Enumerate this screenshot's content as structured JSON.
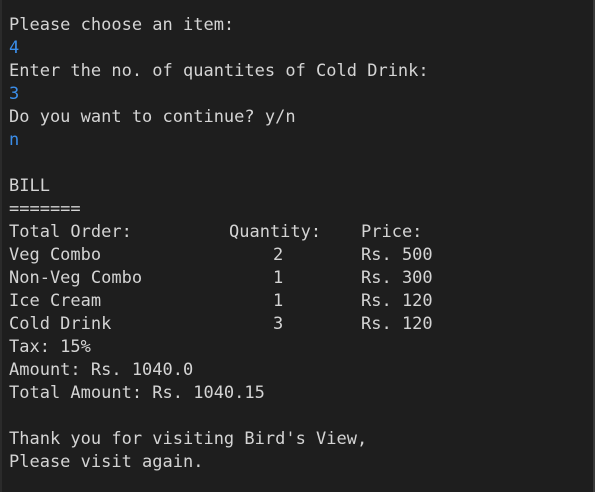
{
  "terminal": {
    "prompt_choose": "Please choose an item:",
    "input_item": "4",
    "prompt_quantity": "Enter the no. of quantites of Cold Drink:",
    "input_quantity": "3",
    "prompt_continue": "Do you want to continue? y/n",
    "input_continue": "n",
    "bill_title": "BILL",
    "bill_rule": "=======",
    "headers": {
      "item": "Total Order:",
      "quantity": "Quantity:",
      "price": "Price:"
    },
    "rows": [
      {
        "item": "Veg Combo",
        "quantity": "2",
        "price": "Rs. 500"
      },
      {
        "item": "Non-Veg Combo",
        "quantity": "1",
        "price": "Rs. 300"
      },
      {
        "item": "Ice Cream",
        "quantity": "1",
        "price": "Rs. 120"
      },
      {
        "item": "Cold Drink",
        "quantity": "3",
        "price": "Rs. 120"
      }
    ],
    "tax": "Tax: 15%",
    "amount": "Amount: Rs. 1040.0",
    "total": "Total Amount: Rs. 1040.15",
    "thanks": "Thank you for visiting Bird's View,",
    "visit_again": "Please visit again."
  },
  "colors": {
    "background": "#1e1e1e",
    "text": "#d4d4d4",
    "user_input": "#3b8eea"
  }
}
